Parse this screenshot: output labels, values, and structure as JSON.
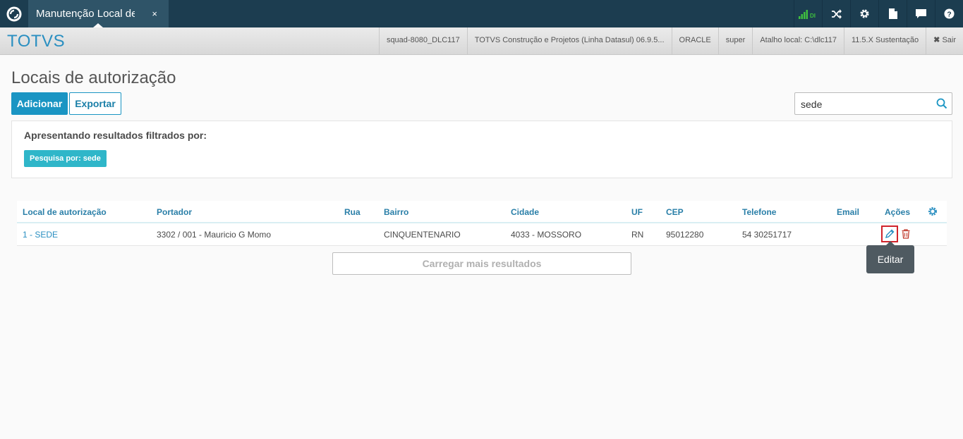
{
  "topbar": {
    "tab_label": "Manutenção Local de Autorização",
    "tab_close": "×",
    "icons": [
      "signal-icon",
      "shuffle-icon",
      "gear-icon",
      "document-icon",
      "chat-icon",
      "help-icon"
    ],
    "signal_label": "DI",
    "colors": {
      "bar": "#1c3d50",
      "tab": "#2f5468",
      "signal": "#3fbf3f"
    }
  },
  "subbar": {
    "brand": "TOTVS",
    "items": [
      "squad-8080_DLC117",
      "TOTVS Construção e Projetos (Linha Datasul) 06.9.5...",
      "ORACLE",
      "super",
      "Atalho local: C:\\dlc117",
      "11.5.X Sustentação"
    ],
    "logout": "Sair"
  },
  "page": {
    "title": "Locais de autorização",
    "add_button": "Adicionar",
    "export_button": "Exportar",
    "search_value": "sede"
  },
  "filter": {
    "title": "Apresentando resultados filtrados por:",
    "chip": "Pesquisa por: sede"
  },
  "table": {
    "headers": [
      "Local de autorização",
      "Portador",
      "Rua",
      "Bairro",
      "Cidade",
      "UF",
      "CEP",
      "Telefone",
      "Email",
      "Ações"
    ],
    "rows": [
      {
        "local": "1 - SEDE",
        "portador": "3302 / 001 - Mauricio G Momo",
        "rua": "",
        "bairro": "CINQUENTENARIO",
        "cidade": "4033 - MOSSORO",
        "uf": "RN",
        "cep": "95012280",
        "telefone": "54 30251717",
        "email": ""
      }
    ],
    "load_more": "Carregar mais resultados"
  },
  "tooltip": "Editar",
  "colors": {
    "accent": "#1a95c3",
    "chip": "#2fb6c9",
    "highlight": "#d0232b",
    "delete": "#c0392b"
  }
}
